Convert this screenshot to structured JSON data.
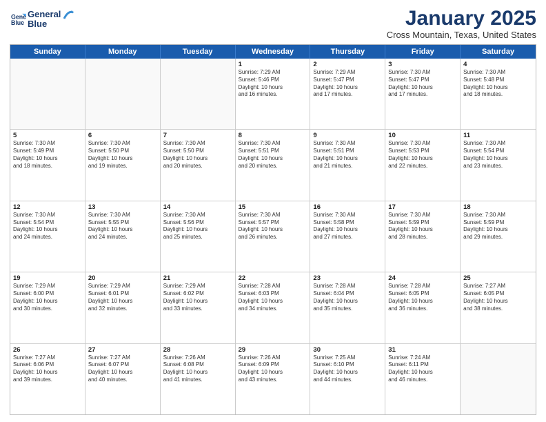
{
  "logo": {
    "line1": "General",
    "line2": "Blue"
  },
  "title": "January 2025",
  "subtitle": "Cross Mountain, Texas, United States",
  "days_of_week": [
    "Sunday",
    "Monday",
    "Tuesday",
    "Wednesday",
    "Thursday",
    "Friday",
    "Saturday"
  ],
  "weeks": [
    [
      {
        "day": "",
        "info": ""
      },
      {
        "day": "",
        "info": ""
      },
      {
        "day": "",
        "info": ""
      },
      {
        "day": "1",
        "info": "Sunrise: 7:29 AM\nSunset: 5:46 PM\nDaylight: 10 hours\nand 16 minutes."
      },
      {
        "day": "2",
        "info": "Sunrise: 7:29 AM\nSunset: 5:47 PM\nDaylight: 10 hours\nand 17 minutes."
      },
      {
        "day": "3",
        "info": "Sunrise: 7:30 AM\nSunset: 5:47 PM\nDaylight: 10 hours\nand 17 minutes."
      },
      {
        "day": "4",
        "info": "Sunrise: 7:30 AM\nSunset: 5:48 PM\nDaylight: 10 hours\nand 18 minutes."
      }
    ],
    [
      {
        "day": "5",
        "info": "Sunrise: 7:30 AM\nSunset: 5:49 PM\nDaylight: 10 hours\nand 18 minutes."
      },
      {
        "day": "6",
        "info": "Sunrise: 7:30 AM\nSunset: 5:50 PM\nDaylight: 10 hours\nand 19 minutes."
      },
      {
        "day": "7",
        "info": "Sunrise: 7:30 AM\nSunset: 5:50 PM\nDaylight: 10 hours\nand 20 minutes."
      },
      {
        "day": "8",
        "info": "Sunrise: 7:30 AM\nSunset: 5:51 PM\nDaylight: 10 hours\nand 20 minutes."
      },
      {
        "day": "9",
        "info": "Sunrise: 7:30 AM\nSunset: 5:51 PM\nDaylight: 10 hours\nand 21 minutes."
      },
      {
        "day": "10",
        "info": "Sunrise: 7:30 AM\nSunset: 5:53 PM\nDaylight: 10 hours\nand 22 minutes."
      },
      {
        "day": "11",
        "info": "Sunrise: 7:30 AM\nSunset: 5:54 PM\nDaylight: 10 hours\nand 23 minutes."
      }
    ],
    [
      {
        "day": "12",
        "info": "Sunrise: 7:30 AM\nSunset: 5:54 PM\nDaylight: 10 hours\nand 24 minutes."
      },
      {
        "day": "13",
        "info": "Sunrise: 7:30 AM\nSunset: 5:55 PM\nDaylight: 10 hours\nand 24 minutes."
      },
      {
        "day": "14",
        "info": "Sunrise: 7:30 AM\nSunset: 5:56 PM\nDaylight: 10 hours\nand 25 minutes."
      },
      {
        "day": "15",
        "info": "Sunrise: 7:30 AM\nSunset: 5:57 PM\nDaylight: 10 hours\nand 26 minutes."
      },
      {
        "day": "16",
        "info": "Sunrise: 7:30 AM\nSunset: 5:58 PM\nDaylight: 10 hours\nand 27 minutes."
      },
      {
        "day": "17",
        "info": "Sunrise: 7:30 AM\nSunset: 5:59 PM\nDaylight: 10 hours\nand 28 minutes."
      },
      {
        "day": "18",
        "info": "Sunrise: 7:30 AM\nSunset: 5:59 PM\nDaylight: 10 hours\nand 29 minutes."
      }
    ],
    [
      {
        "day": "19",
        "info": "Sunrise: 7:29 AM\nSunset: 6:00 PM\nDaylight: 10 hours\nand 30 minutes."
      },
      {
        "day": "20",
        "info": "Sunrise: 7:29 AM\nSunset: 6:01 PM\nDaylight: 10 hours\nand 32 minutes."
      },
      {
        "day": "21",
        "info": "Sunrise: 7:29 AM\nSunset: 6:02 PM\nDaylight: 10 hours\nand 33 minutes."
      },
      {
        "day": "22",
        "info": "Sunrise: 7:28 AM\nSunset: 6:03 PM\nDaylight: 10 hours\nand 34 minutes."
      },
      {
        "day": "23",
        "info": "Sunrise: 7:28 AM\nSunset: 6:04 PM\nDaylight: 10 hours\nand 35 minutes."
      },
      {
        "day": "24",
        "info": "Sunrise: 7:28 AM\nSunset: 6:05 PM\nDaylight: 10 hours\nand 36 minutes."
      },
      {
        "day": "25",
        "info": "Sunrise: 7:27 AM\nSunset: 6:05 PM\nDaylight: 10 hours\nand 38 minutes."
      }
    ],
    [
      {
        "day": "26",
        "info": "Sunrise: 7:27 AM\nSunset: 6:06 PM\nDaylight: 10 hours\nand 39 minutes."
      },
      {
        "day": "27",
        "info": "Sunrise: 7:27 AM\nSunset: 6:07 PM\nDaylight: 10 hours\nand 40 minutes."
      },
      {
        "day": "28",
        "info": "Sunrise: 7:26 AM\nSunset: 6:08 PM\nDaylight: 10 hours\nand 41 minutes."
      },
      {
        "day": "29",
        "info": "Sunrise: 7:26 AM\nSunset: 6:09 PM\nDaylight: 10 hours\nand 43 minutes."
      },
      {
        "day": "30",
        "info": "Sunrise: 7:25 AM\nSunset: 6:10 PM\nDaylight: 10 hours\nand 44 minutes."
      },
      {
        "day": "31",
        "info": "Sunrise: 7:24 AM\nSunset: 6:11 PM\nDaylight: 10 hours\nand 46 minutes."
      },
      {
        "day": "",
        "info": ""
      }
    ]
  ]
}
